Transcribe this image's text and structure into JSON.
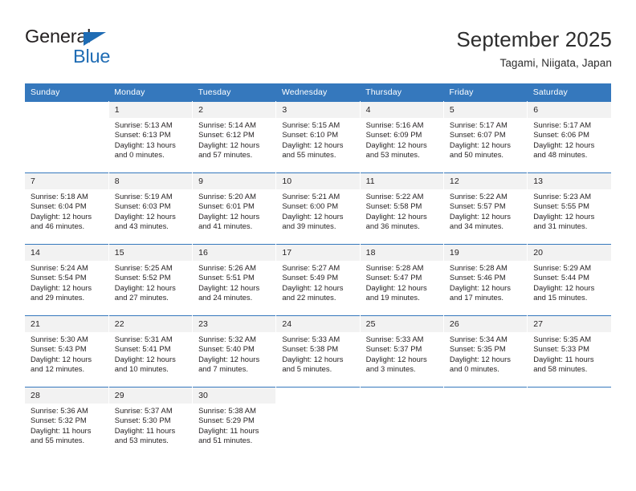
{
  "brand": {
    "word_top": "General",
    "word_bottom": "Blue",
    "accent_color": "#1f6cb4"
  },
  "header": {
    "title": "September 2025",
    "subtitle": "Tagami, Niigata, Japan"
  },
  "calendar": {
    "header_color": "#3578bd",
    "daynum_band_color": "#f2f2f2",
    "weekday_headers": [
      "Sunday",
      "Monday",
      "Tuesday",
      "Wednesday",
      "Thursday",
      "Friday",
      "Saturday"
    ],
    "weeks": [
      [
        {
          "day": "",
          "sunrise": "",
          "sunset": "",
          "daylight_1": "",
          "daylight_2": ""
        },
        {
          "day": "1",
          "sunrise": "Sunrise: 5:13 AM",
          "sunset": "Sunset: 6:13 PM",
          "daylight_1": "Daylight: 13 hours",
          "daylight_2": "and 0 minutes."
        },
        {
          "day": "2",
          "sunrise": "Sunrise: 5:14 AM",
          "sunset": "Sunset: 6:12 PM",
          "daylight_1": "Daylight: 12 hours",
          "daylight_2": "and 57 minutes."
        },
        {
          "day": "3",
          "sunrise": "Sunrise: 5:15 AM",
          "sunset": "Sunset: 6:10 PM",
          "daylight_1": "Daylight: 12 hours",
          "daylight_2": "and 55 minutes."
        },
        {
          "day": "4",
          "sunrise": "Sunrise: 5:16 AM",
          "sunset": "Sunset: 6:09 PM",
          "daylight_1": "Daylight: 12 hours",
          "daylight_2": "and 53 minutes."
        },
        {
          "day": "5",
          "sunrise": "Sunrise: 5:17 AM",
          "sunset": "Sunset: 6:07 PM",
          "daylight_1": "Daylight: 12 hours",
          "daylight_2": "and 50 minutes."
        },
        {
          "day": "6",
          "sunrise": "Sunrise: 5:17 AM",
          "sunset": "Sunset: 6:06 PM",
          "daylight_1": "Daylight: 12 hours",
          "daylight_2": "and 48 minutes."
        }
      ],
      [
        {
          "day": "7",
          "sunrise": "Sunrise: 5:18 AM",
          "sunset": "Sunset: 6:04 PM",
          "daylight_1": "Daylight: 12 hours",
          "daylight_2": "and 46 minutes."
        },
        {
          "day": "8",
          "sunrise": "Sunrise: 5:19 AM",
          "sunset": "Sunset: 6:03 PM",
          "daylight_1": "Daylight: 12 hours",
          "daylight_2": "and 43 minutes."
        },
        {
          "day": "9",
          "sunrise": "Sunrise: 5:20 AM",
          "sunset": "Sunset: 6:01 PM",
          "daylight_1": "Daylight: 12 hours",
          "daylight_2": "and 41 minutes."
        },
        {
          "day": "10",
          "sunrise": "Sunrise: 5:21 AM",
          "sunset": "Sunset: 6:00 PM",
          "daylight_1": "Daylight: 12 hours",
          "daylight_2": "and 39 minutes."
        },
        {
          "day": "11",
          "sunrise": "Sunrise: 5:22 AM",
          "sunset": "Sunset: 5:58 PM",
          "daylight_1": "Daylight: 12 hours",
          "daylight_2": "and 36 minutes."
        },
        {
          "day": "12",
          "sunrise": "Sunrise: 5:22 AM",
          "sunset": "Sunset: 5:57 PM",
          "daylight_1": "Daylight: 12 hours",
          "daylight_2": "and 34 minutes."
        },
        {
          "day": "13",
          "sunrise": "Sunrise: 5:23 AM",
          "sunset": "Sunset: 5:55 PM",
          "daylight_1": "Daylight: 12 hours",
          "daylight_2": "and 31 minutes."
        }
      ],
      [
        {
          "day": "14",
          "sunrise": "Sunrise: 5:24 AM",
          "sunset": "Sunset: 5:54 PM",
          "daylight_1": "Daylight: 12 hours",
          "daylight_2": "and 29 minutes."
        },
        {
          "day": "15",
          "sunrise": "Sunrise: 5:25 AM",
          "sunset": "Sunset: 5:52 PM",
          "daylight_1": "Daylight: 12 hours",
          "daylight_2": "and 27 minutes."
        },
        {
          "day": "16",
          "sunrise": "Sunrise: 5:26 AM",
          "sunset": "Sunset: 5:51 PM",
          "daylight_1": "Daylight: 12 hours",
          "daylight_2": "and 24 minutes."
        },
        {
          "day": "17",
          "sunrise": "Sunrise: 5:27 AM",
          "sunset": "Sunset: 5:49 PM",
          "daylight_1": "Daylight: 12 hours",
          "daylight_2": "and 22 minutes."
        },
        {
          "day": "18",
          "sunrise": "Sunrise: 5:28 AM",
          "sunset": "Sunset: 5:47 PM",
          "daylight_1": "Daylight: 12 hours",
          "daylight_2": "and 19 minutes."
        },
        {
          "day": "19",
          "sunrise": "Sunrise: 5:28 AM",
          "sunset": "Sunset: 5:46 PM",
          "daylight_1": "Daylight: 12 hours",
          "daylight_2": "and 17 minutes."
        },
        {
          "day": "20",
          "sunrise": "Sunrise: 5:29 AM",
          "sunset": "Sunset: 5:44 PM",
          "daylight_1": "Daylight: 12 hours",
          "daylight_2": "and 15 minutes."
        }
      ],
      [
        {
          "day": "21",
          "sunrise": "Sunrise: 5:30 AM",
          "sunset": "Sunset: 5:43 PM",
          "daylight_1": "Daylight: 12 hours",
          "daylight_2": "and 12 minutes."
        },
        {
          "day": "22",
          "sunrise": "Sunrise: 5:31 AM",
          "sunset": "Sunset: 5:41 PM",
          "daylight_1": "Daylight: 12 hours",
          "daylight_2": "and 10 minutes."
        },
        {
          "day": "23",
          "sunrise": "Sunrise: 5:32 AM",
          "sunset": "Sunset: 5:40 PM",
          "daylight_1": "Daylight: 12 hours",
          "daylight_2": "and 7 minutes."
        },
        {
          "day": "24",
          "sunrise": "Sunrise: 5:33 AM",
          "sunset": "Sunset: 5:38 PM",
          "daylight_1": "Daylight: 12 hours",
          "daylight_2": "and 5 minutes."
        },
        {
          "day": "25",
          "sunrise": "Sunrise: 5:33 AM",
          "sunset": "Sunset: 5:37 PM",
          "daylight_1": "Daylight: 12 hours",
          "daylight_2": "and 3 minutes."
        },
        {
          "day": "26",
          "sunrise": "Sunrise: 5:34 AM",
          "sunset": "Sunset: 5:35 PM",
          "daylight_1": "Daylight: 12 hours",
          "daylight_2": "and 0 minutes."
        },
        {
          "day": "27",
          "sunrise": "Sunrise: 5:35 AM",
          "sunset": "Sunset: 5:33 PM",
          "daylight_1": "Daylight: 11 hours",
          "daylight_2": "and 58 minutes."
        }
      ],
      [
        {
          "day": "28",
          "sunrise": "Sunrise: 5:36 AM",
          "sunset": "Sunset: 5:32 PM",
          "daylight_1": "Daylight: 11 hours",
          "daylight_2": "and 55 minutes."
        },
        {
          "day": "29",
          "sunrise": "Sunrise: 5:37 AM",
          "sunset": "Sunset: 5:30 PM",
          "daylight_1": "Daylight: 11 hours",
          "daylight_2": "and 53 minutes."
        },
        {
          "day": "30",
          "sunrise": "Sunrise: 5:38 AM",
          "sunset": "Sunset: 5:29 PM",
          "daylight_1": "Daylight: 11 hours",
          "daylight_2": "and 51 minutes."
        },
        {
          "day": "",
          "sunrise": "",
          "sunset": "",
          "daylight_1": "",
          "daylight_2": ""
        },
        {
          "day": "",
          "sunrise": "",
          "sunset": "",
          "daylight_1": "",
          "daylight_2": ""
        },
        {
          "day": "",
          "sunrise": "",
          "sunset": "",
          "daylight_1": "",
          "daylight_2": ""
        },
        {
          "day": "",
          "sunrise": "",
          "sunset": "",
          "daylight_1": "",
          "daylight_2": ""
        }
      ]
    ]
  }
}
